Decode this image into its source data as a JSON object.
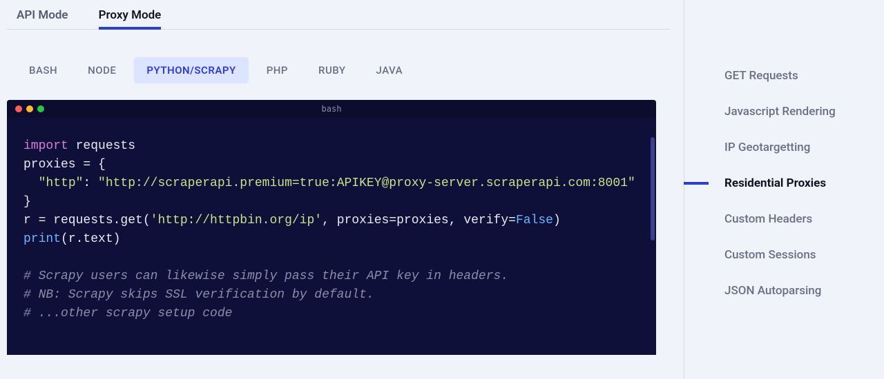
{
  "mode_tabs": [
    {
      "id": "api",
      "label": "API Mode",
      "active": false
    },
    {
      "id": "proxy",
      "label": "Proxy Mode",
      "active": true
    }
  ],
  "lang_tabs": [
    {
      "id": "bash",
      "label": "BASH",
      "active": false
    },
    {
      "id": "node",
      "label": "NODE",
      "active": false
    },
    {
      "id": "python",
      "label": "PYTHON/SCRAPY",
      "active": true
    },
    {
      "id": "php",
      "label": "PHP",
      "active": false
    },
    {
      "id": "ruby",
      "label": "RUBY",
      "active": false
    },
    {
      "id": "java",
      "label": "JAVA",
      "active": false
    }
  ],
  "terminal": {
    "title": "bash",
    "code": {
      "l1_import": "import",
      "l1_requests": " requests",
      "l2": "proxies = {",
      "l3_key": "  \"http\"",
      "l3_colon": ": ",
      "l3_val": "\"http://scraperapi.premium=true:APIKEY@proxy-server.scraperapi.com:8001\"",
      "l4": "}",
      "l5_a": "r = requests.get(",
      "l5_url": "'http://httpbin.org/ip'",
      "l5_b": ", proxies=proxies, verify=",
      "l5_false": "False",
      "l5_c": ")",
      "l6_print": "print",
      "l6_b": "(r.text)",
      "c1": "# Scrapy users can likewise simply pass their API key in headers.",
      "c2": "# NB: Scrapy skips SSL verification by default.",
      "c3": "# ...other scrapy setup code"
    }
  },
  "sidebar": [
    {
      "id": "get",
      "label": "GET Requests",
      "active": false
    },
    {
      "id": "js",
      "label": "Javascript Rendering",
      "active": false
    },
    {
      "id": "geo",
      "label": "IP Geotargetting",
      "active": false
    },
    {
      "id": "res",
      "label": "Residential Proxies",
      "active": true
    },
    {
      "id": "headers",
      "label": "Custom Headers",
      "active": false
    },
    {
      "id": "sess",
      "label": "Custom Sessions",
      "active": false
    },
    {
      "id": "json",
      "label": "JSON Autoparsing",
      "active": false
    }
  ]
}
